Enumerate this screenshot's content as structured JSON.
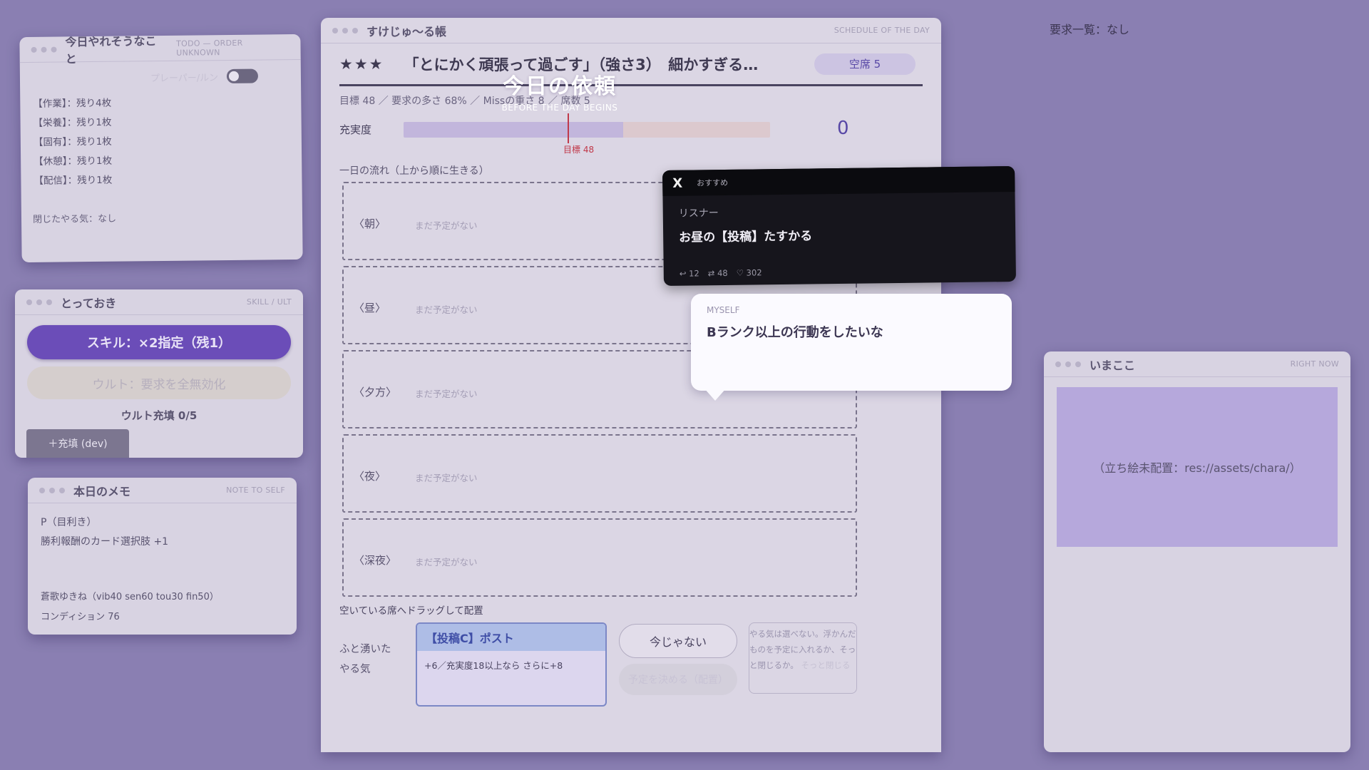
{
  "todo_panel": {
    "title": "今日やれそうなこと",
    "subtitle": "TODO — ORDER UNKNOWN",
    "toggle_label": "プレーパー/ルン",
    "items": [
      "【作業】：残り4枚",
      "【栄養】：残り1枚",
      "【固有】：残り1枚",
      "【休憩】：残り1枚",
      "【配信】：残り1枚"
    ],
    "footer": "閉じたやる気：なし"
  },
  "skill_panel": {
    "title": "とっておき",
    "subtitle": "SKILL / ULT",
    "skill_button": "スキル：×2指定（残1）",
    "ult_button": "ウルト：要求を全無効化",
    "ult_gauge": "ウルト充填 0/5",
    "dev_button": "＋充填 (dev)"
  },
  "memo_panel": {
    "title": "本日のメモ",
    "subtitle": "NOTE TO SELF",
    "lines": [
      "P（目利き）",
      "勝利報酬のカード選択肢 +1"
    ],
    "footer": [
      "蒼歌ゆきね（vib40 sen60 tou30 fin50）",
      "コンディション 76"
    ]
  },
  "schedule": {
    "title": "すけじゅ〜る帳",
    "subtitle": "SCHEDULE OF THE DAY",
    "stars": "★★★",
    "goal_text": "「とにかく頑張って過ごす」（強さ3）　細かすぎる…",
    "seats_pill": "空席 5",
    "stats": "目標 48 ／ 要求の多さ 68% ／ Missの重さ 8 ／ 席数 5",
    "fulfillment_label": "充実度",
    "fulfillment_value": "0",
    "fulfillment_fraction": 0.6,
    "target_marker_label": "目標 48",
    "flow_label": "一日の流れ（上から順に生きる）",
    "slots": [
      {
        "name": "〈朝〉",
        "empty": "まだ予定がない"
      },
      {
        "name": "〈昼〉",
        "empty": "まだ予定がない"
      },
      {
        "name": "〈夕方〉",
        "empty": "まだ予定がない"
      },
      {
        "name": "〈夜〉",
        "empty": "まだ予定がない"
      },
      {
        "name": "〈深夜〉",
        "empty": "まだ予定がない"
      }
    ],
    "drag_hint": "空いている席へドラッグして配置",
    "impulse_label_1": "ふと湧いた",
    "impulse_label_2": "やる気",
    "card_title": "【投稿C】ポスト",
    "card_desc": "+6／充実度18以上なら さらに+8",
    "not_now_button": "今じゃない",
    "ghost_button": "予定を決める（配置）",
    "discard_text": "やる気は選べない。浮かんだものを予定に入れるか、そっと閉じるか。",
    "discard_action": "そっと閉じる"
  },
  "overlay": {
    "title": "今日の依頼",
    "subtitle": "BEFORE THE DAY BEGINS"
  },
  "requests": "要求一覧：なし",
  "tweet": {
    "logo": "X",
    "tag": "おすすめ",
    "user": "リスナー",
    "text": "お昼の【投稿】たすかる",
    "replies": "↩ 12",
    "retweets": "⇄ 48",
    "likes": "♡ 302"
  },
  "bubble": {
    "who": "MYSELF",
    "text": "Bランク以上の行動をしたいな"
  },
  "now_panel": {
    "title": "いまここ",
    "subtitle": "RIGHT NOW",
    "placeholder": "（立ち絵未配置：res://assets/chara/）"
  }
}
